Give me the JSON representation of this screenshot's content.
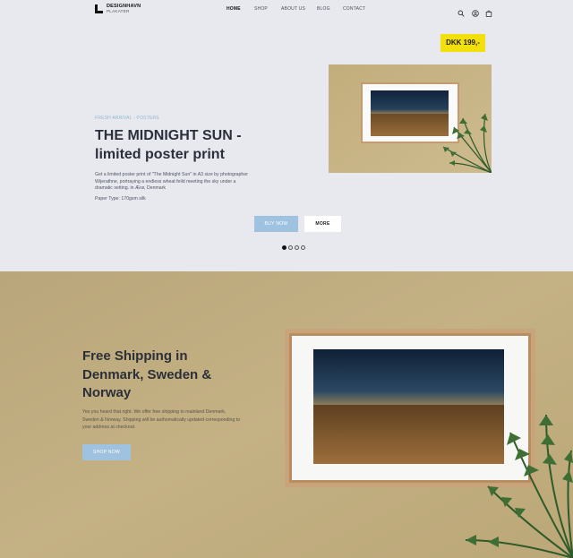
{
  "nav": {
    "logo_title": "DESIGNHAVN",
    "logo_subtitle": "PLAKATER",
    "items": [
      {
        "label": "HOME",
        "active": true
      },
      {
        "label": "SHOP",
        "active": false
      },
      {
        "label": "ABOUT US",
        "active": false
      },
      {
        "label": "BLOG",
        "active": false
      },
      {
        "label": "CONTACT",
        "active": false
      }
    ],
    "icons": [
      "search-icon",
      "user-icon",
      "cart-icon"
    ]
  },
  "hero": {
    "kicker": "FRESH ARRIVAL - POSTERS",
    "title": "THE MIDNIGHT SUN - limited poster print",
    "description": "Get a limited poster print of \"The Midnight Sun\" in A3 size by photographer Wijerathne, portraying a endless wheat feild meeting the sky under a dramatic setting. in Ærø, Denmark",
    "paper": "Paper Type:  170gsm silk",
    "price": "DKK 199,-",
    "buy_label": "BUY NOW",
    "more_label": "MORE",
    "slides": 4,
    "active_slide": 0
  },
  "shipping": {
    "title": "Free Shipping in Denmark, Sweden & Norway",
    "description": "Yes you heard that right. We offer free shipping to mainland Denmark, Sweden & Norway. Shipping will be authomatically updated corresponding to your address at checkout.",
    "button_label": "SHOP NOW"
  },
  "colors": {
    "page_bg": "#e8e9ef",
    "accent_blue": "#9ec2df",
    "price_yellow": "#f2df0b",
    "wall_tan": "#c7b384",
    "heading": "#2a2f3b"
  }
}
